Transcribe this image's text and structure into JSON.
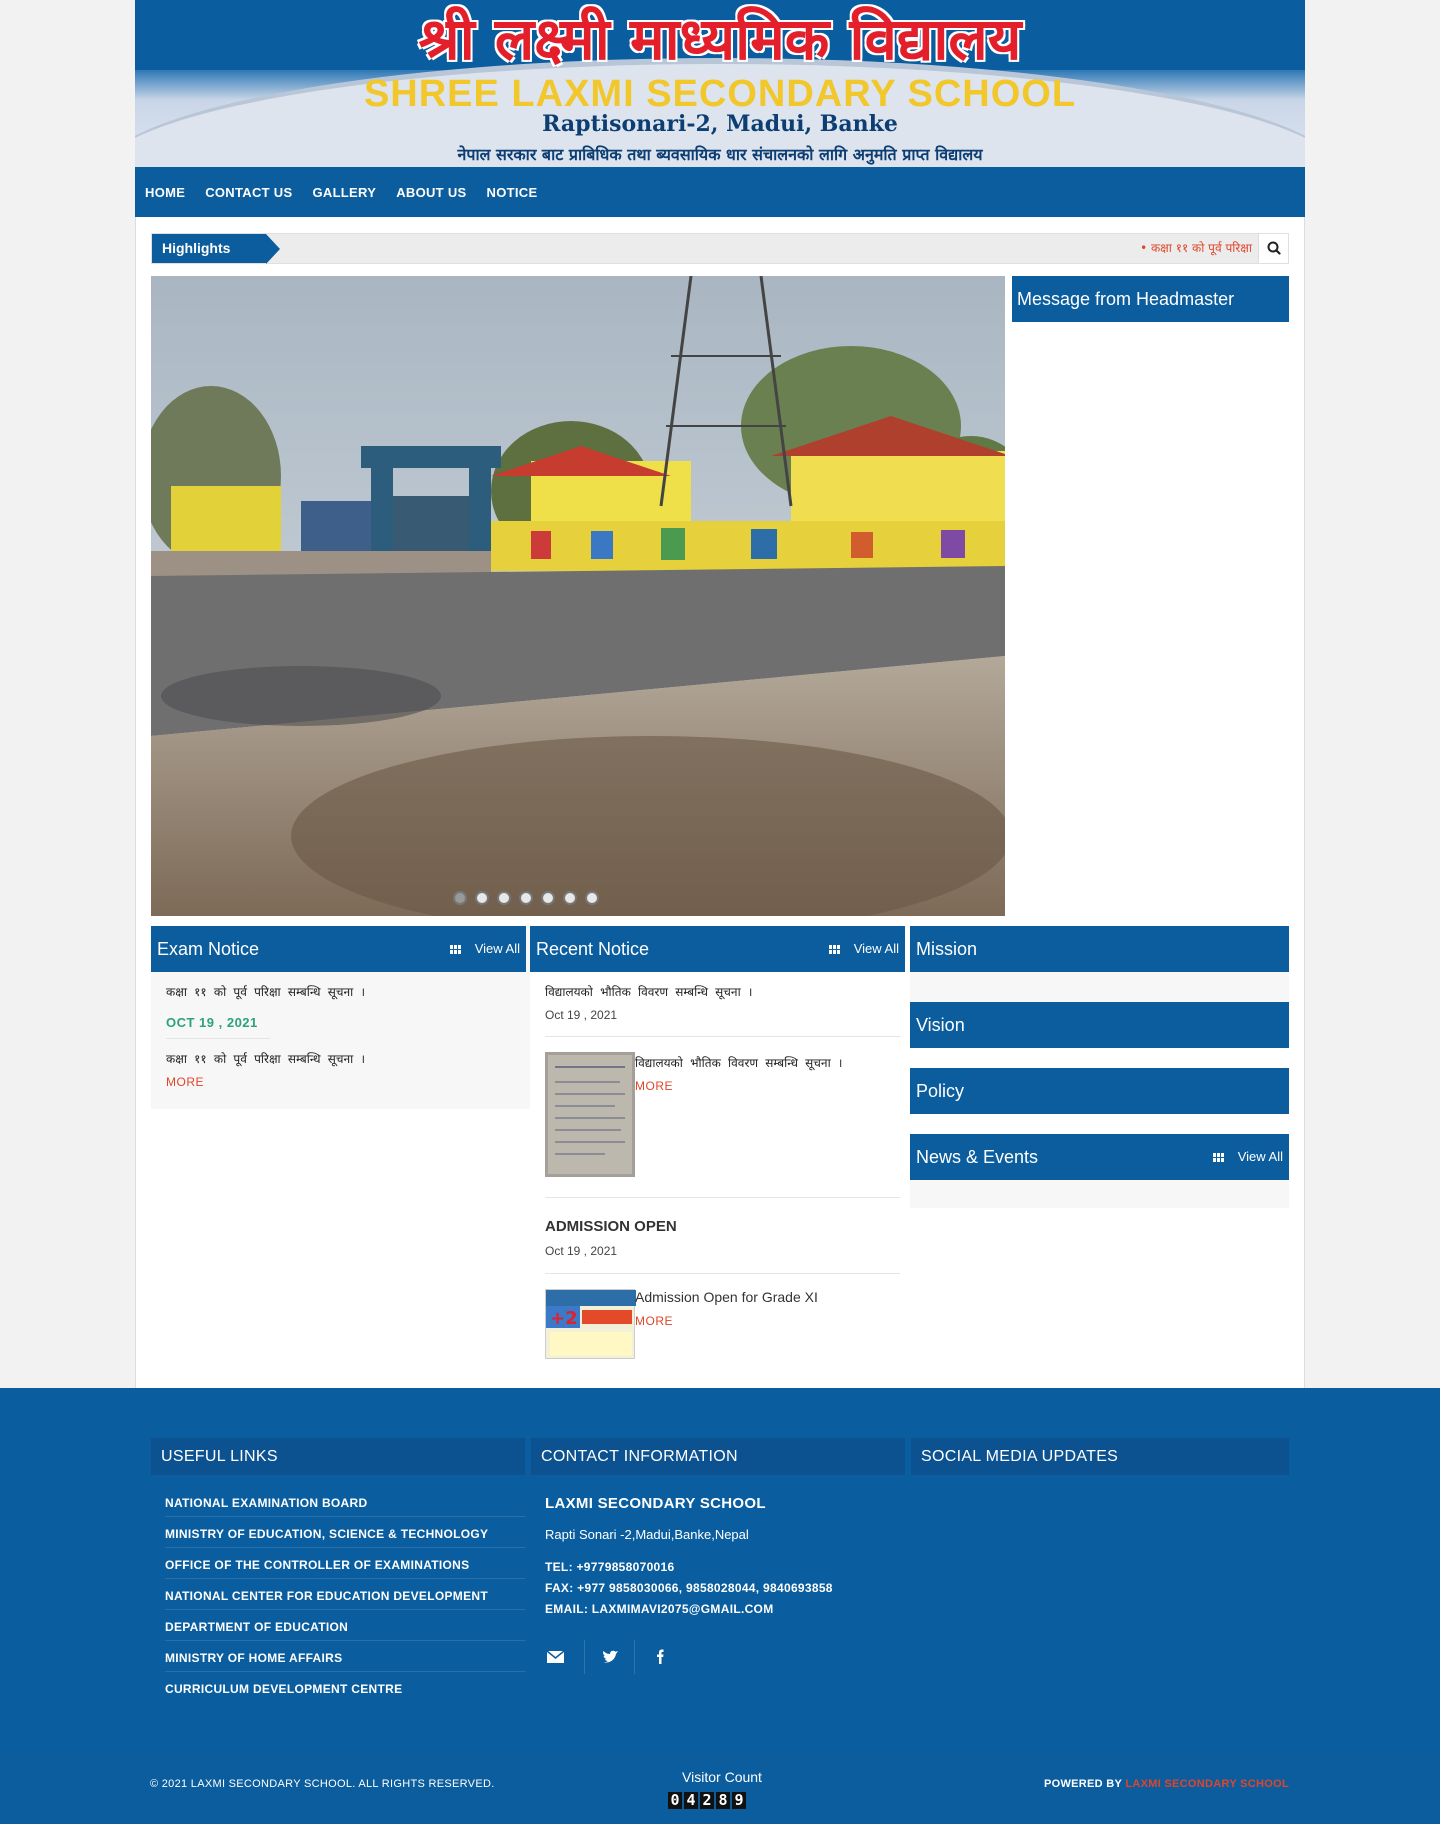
{
  "header": {
    "title_nepali": "श्री लक्ष्मी माध्यमिक विद्यालय",
    "title_english": "SHREE LAXMI SECONDARY SCHOOL",
    "address": "Raptisonari-2, Madui, Banke",
    "tagline": "नेपाल सरकार बाट प्राबिधिक तथा ब्यवसायिक धार संचालनको लागि अनुमति प्राप्त विद्यालय"
  },
  "nav": {
    "items": [
      "HOME",
      "CONTACT US",
      "GALLERY",
      "ABOUT US",
      "NOTICE"
    ]
  },
  "highlights": {
    "label": "Highlights",
    "ticker": "• कक्षा ११ को पूर्व परिक्षा"
  },
  "slider": {
    "dot_count": 7,
    "active_dot": 0
  },
  "headmaster": {
    "title": "Message from Headmaster"
  },
  "exam_notice": {
    "title": "Exam Notice",
    "view_all": "View All",
    "items": [
      {
        "title": "कक्षा ११ को पूर्व परिक्षा सम्बन्धि सूचना ।",
        "date": "OCT 19 , 2021"
      },
      {
        "title": "कक्षा ११ को पूर्व परिक्षा सम्बन्धि सूचना ।",
        "more": "MORE"
      }
    ]
  },
  "recent_notice": {
    "title": "Recent Notice",
    "view_all": "View All",
    "items": [
      {
        "title": "विद्यालयको भौतिक विवरण सम्बन्धि सूचना ।",
        "date": "Oct 19 , 2021",
        "excerpt": "विद्यालयको भौतिक विवरण सम्बन्धि सूचना ।",
        "more": "MORE"
      },
      {
        "title": "ADMISSION OPEN",
        "date": "Oct 19 , 2021",
        "excerpt": "Admission Open for Grade XI",
        "more": "MORE"
      }
    ]
  },
  "right_column": {
    "mission": "Mission",
    "vision": "Vision",
    "policy": "Policy",
    "news_events": "News & Events",
    "view_all": "View All"
  },
  "footer": {
    "useful_links_title": "USEFUL LINKS",
    "useful_links": [
      "NATIONAL EXAMINATION BOARD",
      "MINISTRY OF EDUCATION, SCIENCE & TECHNOLOGY",
      "OFFICE OF THE CONTROLLER OF EXAMINATIONS",
      "NATIONAL CENTER FOR EDUCATION DEVELOPMENT",
      "DEPARTMENT OF EDUCATION",
      "MINISTRY OF HOME AFFAIRS",
      "CURRICULUM DEVELOPMENT CENTRE"
    ],
    "contact_title": "CONTACT INFORMATION",
    "school_name": "LAXMI SECONDARY SCHOOL",
    "address": "Rapti Sonari -2,Madui,Banke,Nepal",
    "tel": "TEL: +9779858070016",
    "fax": "FAX: +977 9858030066, 9858028044, 9840693858",
    "email": "EMAIL: LAXMIMAVI2075@GMAIL.COM",
    "social_title": "SOCIAL MEDIA UPDATES",
    "copyright": "© 2021 LAXMI SECONDARY SCHOOL. ALL RIGHTS RESERVED.",
    "visitor_label": "Visitor Count",
    "visitor_digits": [
      "0",
      "4",
      "2",
      "8",
      "9"
    ],
    "powered_by": "POWERED BY",
    "powered_name": "LAXMI SECONDARY SCHOOL"
  },
  "colors": {
    "primary_blue": "#0b5d9e",
    "accent_red": "#e0452b",
    "date_green": "#2aa37a",
    "title_yellow": "#f1c72b",
    "title_red": "#e21f2a"
  }
}
